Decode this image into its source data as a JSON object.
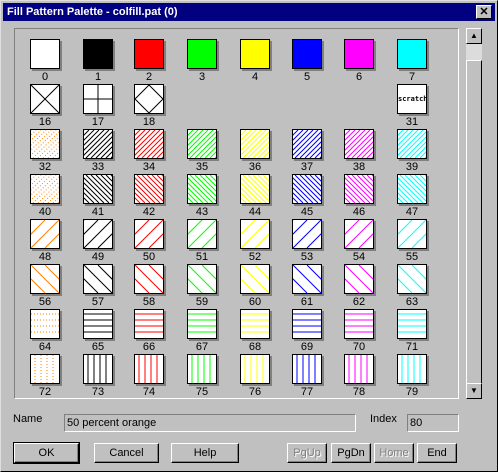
{
  "window": {
    "title": "Fill Pattern Palette - colfill.pat (0)",
    "close_symbol": "✕"
  },
  "colors": {
    "orange": "#ff8000",
    "black": "#000000",
    "red": "#ff0000",
    "green": "#00ff00",
    "yellow": "#ffff00",
    "blue": "#0000ff",
    "magenta": "#ff00ff",
    "cyan": "#00ffff"
  },
  "palette": {
    "cells": [
      {
        "label": "0",
        "kind": "solid",
        "color": "#ffffff"
      },
      {
        "label": "1",
        "kind": "solid",
        "color": "#000000"
      },
      {
        "label": "2",
        "kind": "solid",
        "color": "#ff0000"
      },
      {
        "label": "3",
        "kind": "solid",
        "color": "#00ff00"
      },
      {
        "label": "4",
        "kind": "solid",
        "color": "#ffff00"
      },
      {
        "label": "5",
        "kind": "solid",
        "color": "#0000ff"
      },
      {
        "label": "6",
        "kind": "solid",
        "color": "#ff00ff"
      },
      {
        "label": "7",
        "kind": "solid",
        "color": "#00ffff"
      },
      {
        "label": "16",
        "kind": "x"
      },
      {
        "label": "17",
        "kind": "plus"
      },
      {
        "label": "18",
        "kind": "diamond"
      },
      {
        "label": "31",
        "kind": "scratch",
        "text": "scratch"
      },
      {
        "label": "32",
        "kind": "dots",
        "color": "#ff8000"
      },
      {
        "label": "33",
        "kind": "diag",
        "color": "#000000"
      },
      {
        "label": "34",
        "kind": "diag",
        "color": "#ff0000"
      },
      {
        "label": "35",
        "kind": "diag",
        "color": "#00ff00"
      },
      {
        "label": "36",
        "kind": "diag",
        "color": "#ffff00"
      },
      {
        "label": "37",
        "kind": "diag",
        "color": "#0000ff"
      },
      {
        "label": "38",
        "kind": "diag",
        "color": "#ff00ff"
      },
      {
        "label": "39",
        "kind": "diag",
        "color": "#00ffff"
      },
      {
        "label": "40",
        "kind": "dots",
        "color": "#ff8000"
      },
      {
        "label": "41",
        "kind": "bdiag",
        "color": "#000000"
      },
      {
        "label": "42",
        "kind": "bdiag",
        "color": "#ff0000"
      },
      {
        "label": "43",
        "kind": "bdiag",
        "color": "#00ff00"
      },
      {
        "label": "44",
        "kind": "bdiag",
        "color": "#ffff00"
      },
      {
        "label": "45",
        "kind": "bdiag",
        "color": "#0000ff"
      },
      {
        "label": "46",
        "kind": "bdiag",
        "color": "#ff00ff"
      },
      {
        "label": "47",
        "kind": "bdiag",
        "color": "#00ffff"
      },
      {
        "label": "48",
        "kind": "sparse-diag",
        "color": "#ff8000"
      },
      {
        "label": "49",
        "kind": "sparse-diag",
        "color": "#000000"
      },
      {
        "label": "50",
        "kind": "sparse-diag",
        "color": "#ff0000"
      },
      {
        "label": "51",
        "kind": "sparse-diag",
        "color": "#00ff00"
      },
      {
        "label": "52",
        "kind": "sparse-diag",
        "color": "#ffff00"
      },
      {
        "label": "53",
        "kind": "sparse-diag",
        "color": "#0000ff"
      },
      {
        "label": "54",
        "kind": "sparse-diag",
        "color": "#ff00ff"
      },
      {
        "label": "55",
        "kind": "sparse-diag",
        "color": "#00ffff"
      },
      {
        "label": "56",
        "kind": "sparse-bdiag",
        "color": "#ff8000"
      },
      {
        "label": "57",
        "kind": "sparse-bdiag",
        "color": "#000000"
      },
      {
        "label": "58",
        "kind": "sparse-bdiag",
        "color": "#ff0000"
      },
      {
        "label": "59",
        "kind": "sparse-bdiag",
        "color": "#00ff00"
      },
      {
        "label": "60",
        "kind": "sparse-bdiag",
        "color": "#ffff00"
      },
      {
        "label": "61",
        "kind": "sparse-bdiag",
        "color": "#0000ff"
      },
      {
        "label": "62",
        "kind": "sparse-bdiag",
        "color": "#ff00ff"
      },
      {
        "label": "63",
        "kind": "sparse-bdiag",
        "color": "#00ffff"
      },
      {
        "label": "64",
        "kind": "hdots",
        "color": "#ff8000"
      },
      {
        "label": "65",
        "kind": "horiz",
        "color": "#000000"
      },
      {
        "label": "66",
        "kind": "horiz",
        "color": "#ff0000"
      },
      {
        "label": "67",
        "kind": "horiz",
        "color": "#00ff00"
      },
      {
        "label": "68",
        "kind": "horiz",
        "color": "#ffff00"
      },
      {
        "label": "69",
        "kind": "horiz",
        "color": "#0000ff"
      },
      {
        "label": "70",
        "kind": "horiz",
        "color": "#ff00ff"
      },
      {
        "label": "71",
        "kind": "horiz",
        "color": "#00ffff"
      },
      {
        "label": "72",
        "kind": "vdots",
        "color": "#ff8000"
      },
      {
        "label": "73",
        "kind": "vert",
        "color": "#000000"
      },
      {
        "label": "74",
        "kind": "vert",
        "color": "#ff0000"
      },
      {
        "label": "75",
        "kind": "vert",
        "color": "#00ff00"
      },
      {
        "label": "76",
        "kind": "vert",
        "color": "#ffff00"
      },
      {
        "label": "77",
        "kind": "vert",
        "color": "#0000ff"
      },
      {
        "label": "78",
        "kind": "vert",
        "color": "#ff00ff"
      },
      {
        "label": "79",
        "kind": "vert",
        "color": "#00ffff"
      }
    ]
  },
  "scrollbar": {
    "up_icon": "up-arrow-icon",
    "down_icon": "down-arrow-icon",
    "up_glyph": "▲",
    "down_glyph": "▼"
  },
  "details": {
    "name_label": "Name",
    "name_value": "50 percent orange",
    "index_label": "Index",
    "index_value": "80"
  },
  "buttons": {
    "ok": "OK",
    "cancel": "Cancel",
    "help": "Help",
    "pgup": "PgUp",
    "pgdn": "PgDn",
    "home": "Home",
    "end": "End"
  }
}
